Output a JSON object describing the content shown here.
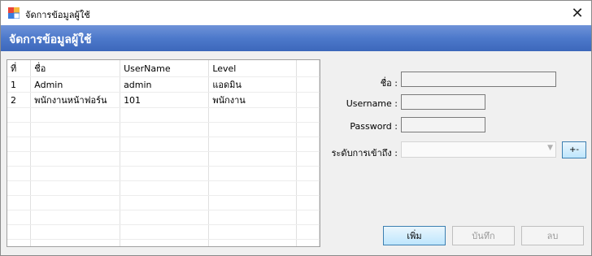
{
  "window": {
    "title": "จัดการข้อมูลผู้ใช้",
    "close_glyph": "✕"
  },
  "header": {
    "title": "จัดการข้อมูลผู้ใช้"
  },
  "grid": {
    "columns": [
      "ที่",
      "ชื่อ",
      "UserName",
      "Level"
    ],
    "rows": [
      [
        "1",
        "Admin",
        "admin",
        "แอดมิน"
      ],
      [
        "2",
        "พนักงานหน้าฟอร์น",
        "101",
        "พนักงาน"
      ]
    ]
  },
  "form": {
    "name_label": "ชื่อ :",
    "name_value": "",
    "username_label": "Username :",
    "username_value": "",
    "password_label": "Password :",
    "password_value": "",
    "access_label": "ระดับการเข้าถึง :",
    "access_value": "",
    "access_button_label": "+-"
  },
  "buttons": {
    "add": "เพิ่ม",
    "save": "บันทึก",
    "delete": "ลบ"
  }
}
